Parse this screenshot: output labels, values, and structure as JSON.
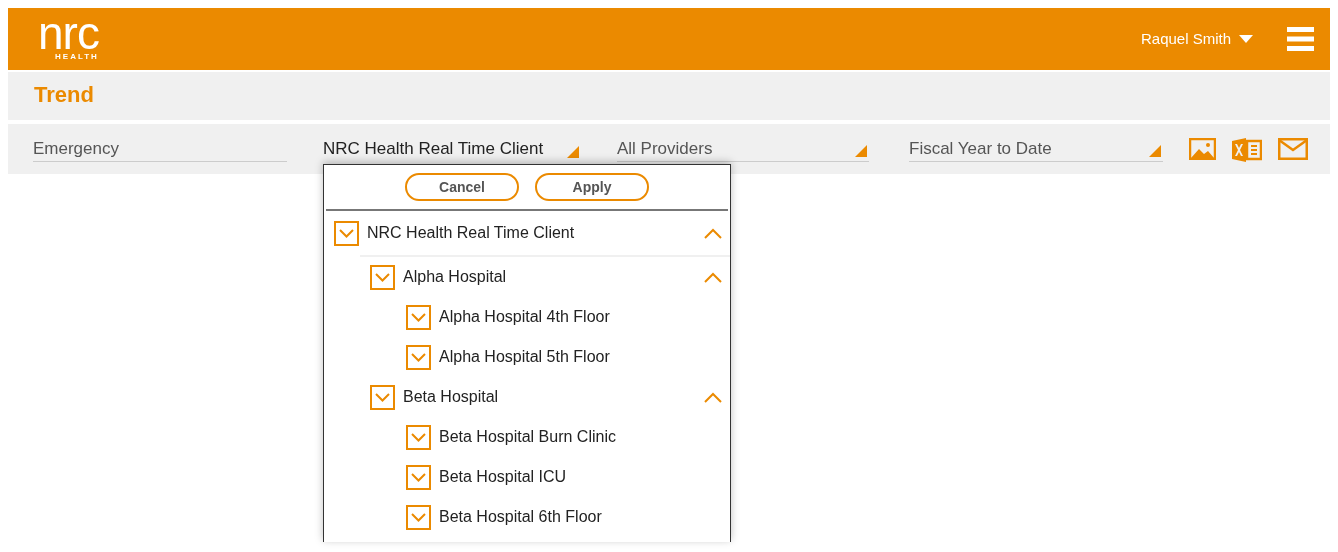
{
  "header": {
    "logo": {
      "word": "nrc",
      "sub": "HEALTH"
    },
    "user": "Raquel Smith"
  },
  "page_title": "Trend",
  "filters": [
    {
      "value": "Emergency",
      "kind": "plain"
    },
    {
      "value": "NRC Health Real Time Client",
      "kind": "select",
      "open": true
    },
    {
      "value": "All Providers",
      "kind": "select",
      "open": false
    },
    {
      "value": "Fiscal Year to Date",
      "kind": "select",
      "open": false
    }
  ],
  "dropdown": {
    "buttons": [
      "Cancel",
      "Apply"
    ],
    "tree": [
      {
        "label": "NRC Health Real Time Client",
        "checked": true,
        "expanded": true,
        "children": [
          {
            "label": "Alpha Hospital",
            "checked": true,
            "expanded": true,
            "children": [
              {
                "label": "Alpha Hospital 4th Floor",
                "checked": true
              },
              {
                "label": "Alpha Hospital 5th Floor",
                "checked": true
              }
            ]
          },
          {
            "label": "Beta Hospital",
            "checked": true,
            "expanded": true,
            "children": [
              {
                "label": "Beta Hospital Burn Clinic",
                "checked": true
              },
              {
                "label": "Beta Hospital ICU",
                "checked": true
              },
              {
                "label": "Beta Hospital 6th Floor",
                "checked": true
              }
            ]
          }
        ]
      }
    ]
  }
}
